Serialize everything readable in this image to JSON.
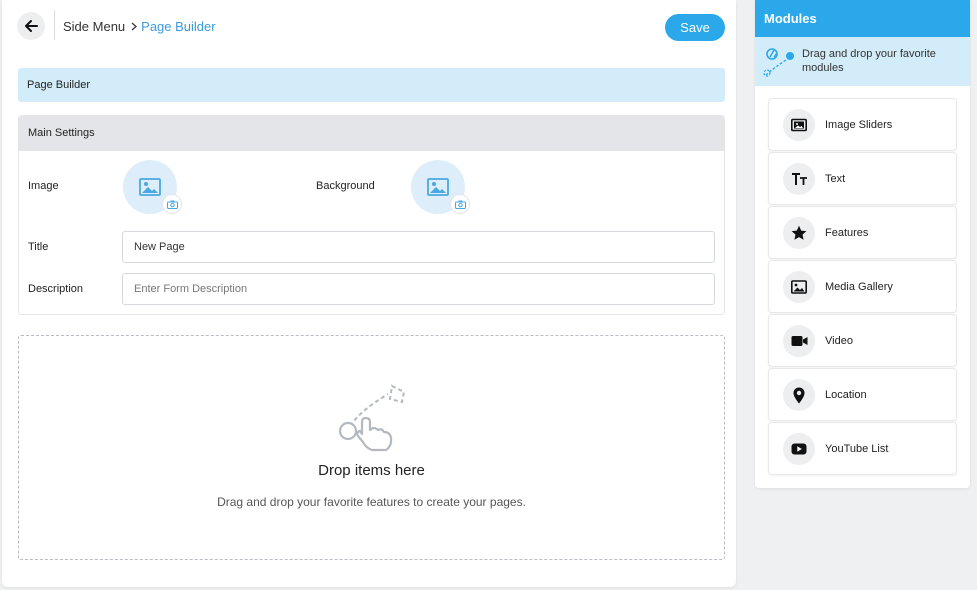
{
  "header": {
    "breadcrumb_root": "Side Menu",
    "breadcrumb_current": "Page Builder",
    "save_label": "Save"
  },
  "page_builder": {
    "banner_title": "Page Builder"
  },
  "main_settings": {
    "title": "Main Settings",
    "image_label": "Image",
    "background_label": "Background",
    "title_label": "Title",
    "title_value": "New Page",
    "description_label": "Description",
    "description_placeholder": "Enter Form Description"
  },
  "dropzone": {
    "title": "Drop items here",
    "subtitle": "Drag and drop your favorite features to create your pages."
  },
  "modules_panel": {
    "title": "Modules",
    "hint": "Drag and drop your favorite modules",
    "items": [
      {
        "label": "Image Sliders",
        "icon": "image-slider-icon"
      },
      {
        "label": "Text",
        "icon": "text-icon"
      },
      {
        "label": "Features",
        "icon": "star-icon"
      },
      {
        "label": "Media Gallery",
        "icon": "media-gallery-icon"
      },
      {
        "label": "Video",
        "icon": "video-icon"
      },
      {
        "label": "Location",
        "icon": "location-pin-icon"
      },
      {
        "label": "YouTube List",
        "icon": "youtube-icon"
      }
    ]
  },
  "colors": {
    "accent": "#2aa8ea",
    "accent_light": "#d3ecf9",
    "link": "#3a9ad9"
  }
}
